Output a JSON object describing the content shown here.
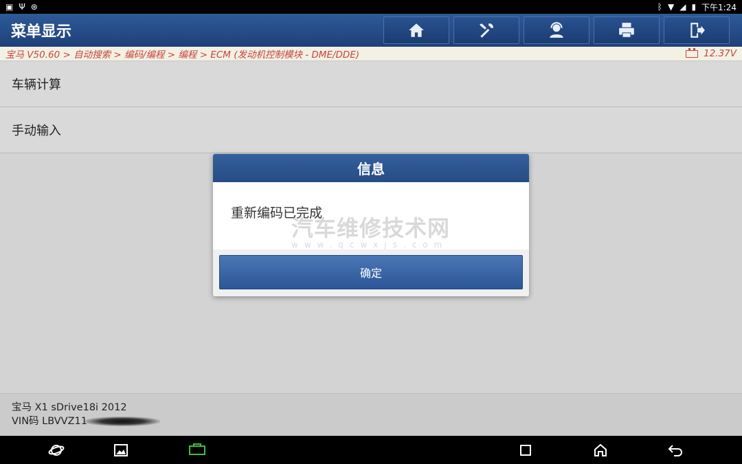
{
  "status_bar": {
    "time": "下午1:24",
    "left_icons": [
      "image-icon",
      "usb-icon",
      "settings-icon"
    ],
    "right_icons": [
      "bluetooth-icon",
      "wifi-icon",
      "signal-icon",
      "battery-icon"
    ]
  },
  "header": {
    "title": "菜单显示",
    "toolbar": [
      {
        "name": "home-icon"
      },
      {
        "name": "tools-icon"
      },
      {
        "name": "support-icon"
      },
      {
        "name": "print-icon"
      },
      {
        "name": "exit-icon"
      }
    ]
  },
  "breadcrumb": {
    "path": "宝马 V50.60 > 自动搜索 > 编码/编程 > 编程 > ECM (发动机控制模块 - DME/DDE)",
    "voltage": "12.37V"
  },
  "menu": {
    "items": [
      {
        "label": "车辆计算"
      },
      {
        "label": "手动输入"
      }
    ]
  },
  "vehicle": {
    "model": "宝马 X1 sDrive18i 2012",
    "vin": "VIN码 LBVVZ11"
  },
  "dialog": {
    "title": "信息",
    "message": "重新编码已完成",
    "ok_label": "确定",
    "watermark_main": "汽车维修技术网",
    "watermark_sub": "www.qcwxjs.com"
  },
  "colors": {
    "header_blue": "#1d4178",
    "breadcrumb_red": "#c8463a",
    "button_blue": "#3a66a6"
  }
}
